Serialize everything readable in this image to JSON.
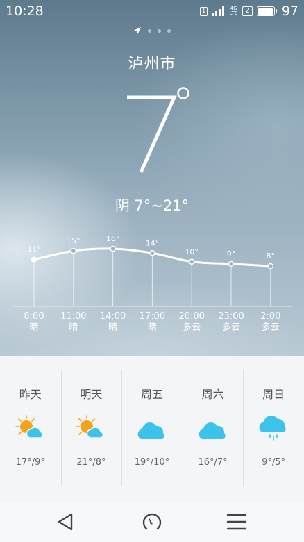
{
  "status_bar": {
    "time": "10:28",
    "sim1_label": "1",
    "network": "4G LTE",
    "sim2_label": "2",
    "battery_level": "97",
    "battery_fraction": 0.97
  },
  "pager": {
    "pages": 4,
    "active": 0,
    "current_icon": "location-arrow-icon"
  },
  "city": "泸州市",
  "current": {
    "temperature": "7",
    "degree_symbol": "°"
  },
  "today_range": "阴 7°~21°",
  "hourly": [
    {
      "time": "8:00",
      "temp": 11,
      "temp_label": "11°",
      "cond": "晴"
    },
    {
      "time": "11:00",
      "temp": 15,
      "temp_label": "15°",
      "cond": "晴"
    },
    {
      "time": "14:00",
      "temp": 16,
      "temp_label": "16°",
      "cond": "晴"
    },
    {
      "time": "17:00",
      "temp": 14,
      "temp_label": "14°",
      "cond": "晴"
    },
    {
      "time": "20:00",
      "temp": 10,
      "temp_label": "10°",
      "cond": "多云"
    },
    {
      "time": "23:00",
      "temp": 9,
      "temp_label": "9°",
      "cond": "多云"
    },
    {
      "time": "2:00",
      "temp": 8,
      "temp_label": "8°",
      "cond": "多云"
    }
  ],
  "forecast": [
    {
      "day": "昨天",
      "icon": "partly-sunny-icon",
      "temps": "17°/9°"
    },
    {
      "day": "明天",
      "icon": "partly-sunny-icon",
      "temps": "21°/8°"
    },
    {
      "day": "周五",
      "icon": "cloud-icon",
      "temps": "19°/10°"
    },
    {
      "day": "周六",
      "icon": "cloud-icon",
      "temps": "16°/7°"
    },
    {
      "day": "周日",
      "icon": "rain-cloud-icon",
      "temps": "9°/5°"
    }
  ],
  "navbar": {
    "back_icon": "back-triangle-icon",
    "home_icon": "gauge-icon",
    "menu_icon": "menu-icon"
  },
  "colors": {
    "sun": "#f7a21b",
    "cloud": "#3cc3ea",
    "nav_icon": "#444444"
  }
}
